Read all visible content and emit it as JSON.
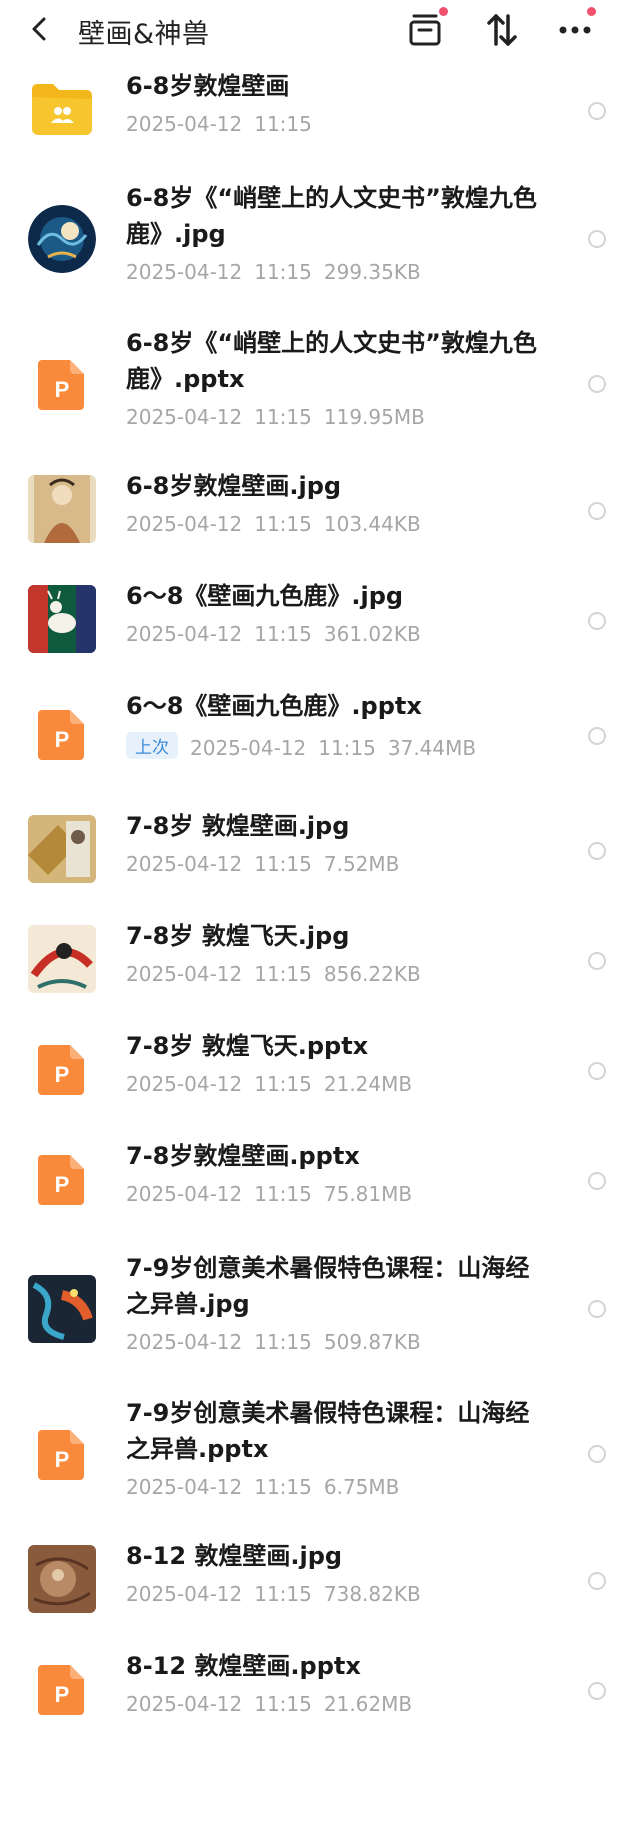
{
  "header": {
    "title": "壁画&神兽"
  },
  "items": [
    {
      "type": "folder",
      "name": "6-8岁敦煌壁画",
      "date": "2025-04-12",
      "time": "11:15",
      "size": ""
    },
    {
      "type": "img-deer-night",
      "name": "6-8岁《“峭壁上的人文史书”敦煌九色鹿》.jpg",
      "date": "2025-04-12",
      "time": "11:15",
      "size": "299.35KB"
    },
    {
      "type": "ppt",
      "name": "6-8岁《“峭壁上的人文史书”敦煌九色鹿》.pptx",
      "date": "2025-04-12",
      "time": "11:15",
      "size": "119.95MB"
    },
    {
      "type": "img-mural",
      "name": "6-8岁敦煌壁画.jpg",
      "date": "2025-04-12",
      "time": "11:15",
      "size": "103.44KB"
    },
    {
      "type": "img-deer-green",
      "name": "6～8《壁画九色鹿》.jpg",
      "date": "2025-04-12",
      "time": "11:15",
      "size": "361.02KB"
    },
    {
      "type": "ppt",
      "name": "6～8《壁画九色鹿》.pptx",
      "date": "2025-04-12",
      "time": "11:15",
      "size": "37.44MB",
      "tag": "上次"
    },
    {
      "type": "img-gold",
      "name": "7-8岁 敦煌壁画.jpg",
      "date": "2025-04-12",
      "time": "11:15",
      "size": "7.52MB"
    },
    {
      "type": "img-feitian",
      "name": "7-8岁 敦煌飞天.jpg",
      "date": "2025-04-12",
      "time": "11:15",
      "size": "856.22KB"
    },
    {
      "type": "ppt",
      "name": "7-8岁 敦煌飞天.pptx",
      "date": "2025-04-12",
      "time": "11:15",
      "size": "21.24MB"
    },
    {
      "type": "ppt",
      "name": "7-8岁敦煌壁画.pptx",
      "date": "2025-04-12",
      "time": "11:15",
      "size": "75.81MB"
    },
    {
      "type": "img-beast",
      "name": "7-9岁创意美术暑假特色课程：山海经之异兽.jpg",
      "date": "2025-04-12",
      "time": "11:15",
      "size": "509.87KB"
    },
    {
      "type": "ppt",
      "name": "7-9岁创意美术暑假特色课程：山海经之异兽.pptx",
      "date": "2025-04-12",
      "time": "11:15",
      "size": "6.75MB"
    },
    {
      "type": "img-brown",
      "name": "8-12 敦煌壁画.jpg",
      "date": "2025-04-12",
      "time": "11:15",
      "size": "738.82KB"
    },
    {
      "type": "ppt",
      "name": "8-12 敦煌壁画.pptx",
      "date": "2025-04-12",
      "time": "11:15",
      "size": "21.62MB"
    }
  ]
}
